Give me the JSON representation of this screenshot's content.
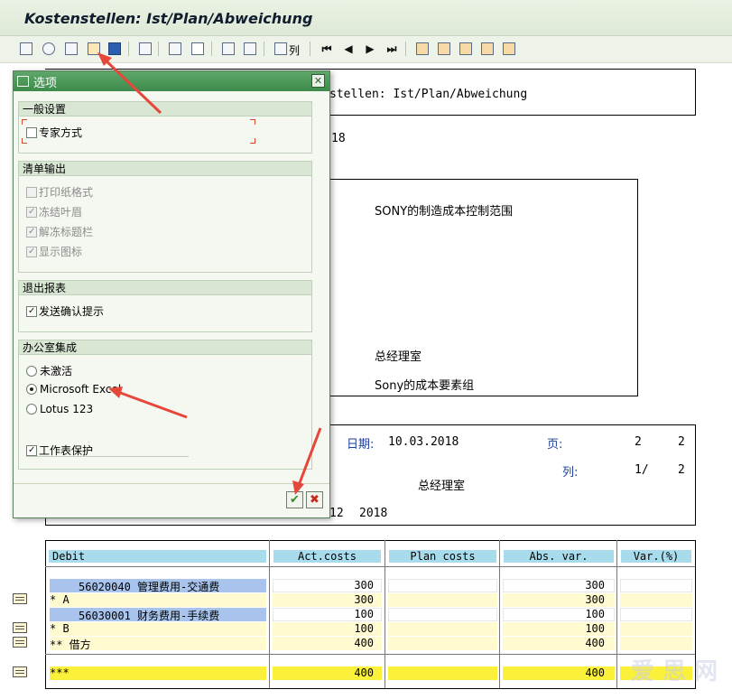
{
  "window": {
    "title": "Kostenstellen: Ist/Plan/Abweichung"
  },
  "toolbar": {
    "icons": [
      "hierarchy-icon",
      "find-icon",
      "binoculars-icon",
      "layout-icon",
      "info-icon",
      "filter-icon",
      "drilldown-icon",
      "columns-icon",
      "print-icon",
      "summary-icon",
      "columns-label-icon",
      "first-icon",
      "prev-icon",
      "next-icon",
      "last-icon",
      "expand-icon",
      "collapse-icon",
      "tree-icon",
      "tree2-icon"
    ],
    "columns_label": "列"
  },
  "report": {
    "header_title": "stellen: Ist/Plan/Abweichung",
    "header_year": "18",
    "controlling_area": "SONY的制造成本控制范围",
    "cost_center_group": "总经理室",
    "cost_element_group": "Sony的成本要素组",
    "date_label": "日期:",
    "date_value": "10.03.2018",
    "page_label": "页:",
    "page_current": "2",
    "page_total": "2",
    "col_label": "列:",
    "col_current": "1/",
    "col_total": "2",
    "sub_title": "总经理室",
    "period_text": "12",
    "period_year": "2018",
    "table_headers": [
      "Debit",
      "Act.costs",
      "Plan costs",
      "Abs. var.",
      "Var.(%)"
    ],
    "rows": [
      {
        "label": "56020040  管理费用-交通费",
        "act": "300",
        "abs": "300",
        "style": "detail"
      },
      {
        "label": "*   A",
        "act": "300",
        "abs": "300",
        "style": "sum1"
      },
      {
        "label": "56030001  财务费用-手续费",
        "act": "100",
        "abs": "100",
        "style": "detail"
      },
      {
        "label": "*   B",
        "act": "100",
        "abs": "100",
        "style": "sum1"
      },
      {
        "label": "**  借方",
        "act": "400",
        "abs": "400",
        "style": "sum1"
      },
      {
        "label": "***",
        "act": "400",
        "abs": "400",
        "style": "total"
      }
    ]
  },
  "dialog": {
    "title": "选项",
    "groups": {
      "general": {
        "title": "一般设置",
        "expert_mode": "专家方式"
      },
      "list_output": {
        "title": "清单输出",
        "print_format": "打印纸格式",
        "freeze_header": "冻结叶眉",
        "unfreeze_title": "解冻标题栏",
        "show_icons": "显示图标"
      },
      "exit": {
        "title": "退出报表",
        "confirm": "发送确认提示"
      },
      "office": {
        "title": "办公室集成",
        "inactive": "未激活",
        "excel": "Microsoft Excel",
        "lotus": "Lotus 123",
        "sheet_protect": "工作表保护"
      }
    },
    "ok_symbol": "✔",
    "cancel_symbol": "✖",
    "close_symbol": "✕"
  },
  "watermark": "爱 思 网"
}
